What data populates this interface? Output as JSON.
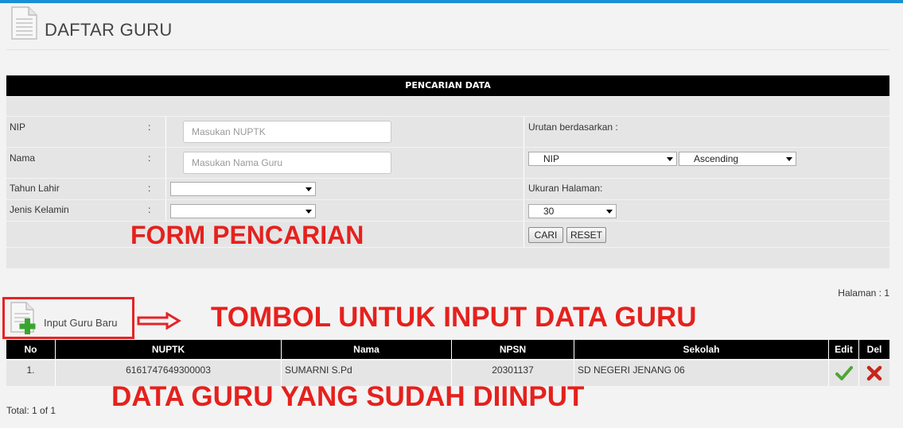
{
  "page": {
    "title": "DAFTAR GURU"
  },
  "search": {
    "header": "PENCARIAN DATA",
    "nip_label": "NIP",
    "nip_placeholder": "Masukan NUPTK",
    "nama_label": "Nama",
    "nama_placeholder": "Masukan Nama Guru",
    "tahun_lahir_label": "Tahun Lahir",
    "tahun_lahir_value": "",
    "jenis_kelamin_label": "Jenis Kelamin",
    "jenis_kelamin_value": "",
    "colon": ":",
    "urutan_label": "Urutan berdasarkan :",
    "urutan_field": "NIP",
    "urutan_order": "Ascending",
    "ukuran_label": "Ukuran Halaman:",
    "ukuran_value": "30",
    "cari_button": "CARI",
    "reset_button": "RESET"
  },
  "annotations": {
    "form": "FORM PENCARIAN",
    "input_button": "TOMBOL UNTUK INPUT DATA GURU",
    "data": "DATA GURU YANG SUDAH DIINPUT"
  },
  "pagination": {
    "halaman": "Halaman : 1",
    "total": "Total: 1 of 1"
  },
  "input_button_label": "Input Guru Baru",
  "table": {
    "columns": [
      "No",
      "NUPTK",
      "Nama",
      "NPSN",
      "Sekolah",
      "Edit",
      "Del"
    ],
    "rows": [
      {
        "no": "1.",
        "nuptk": "6161747649300003",
        "nama": "SUMARNI S.Pd",
        "npsn": "20301137",
        "sekolah": "SD NEGERI JENANG 06"
      }
    ]
  },
  "colors": {
    "accent_topbar": "#1a8fd8",
    "annotation_red": "#e5211d",
    "header_black": "#000000",
    "row_gray": "#e5e5e5"
  },
  "icons": {
    "page": "document-icon",
    "add": "document-add-icon",
    "edit": "check-icon",
    "delete": "x-icon"
  }
}
